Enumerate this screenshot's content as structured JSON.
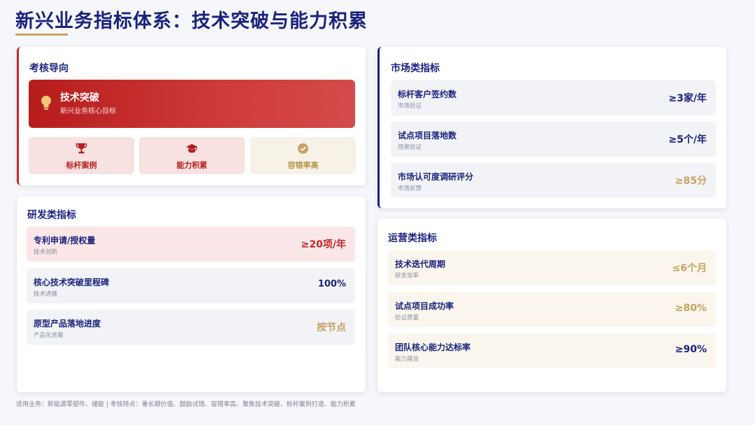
{
  "page": {
    "title": "新兴业务指标体系：技术突破与能力积累",
    "footer": "适用业务：新能源零部件、储能 | 考核特点：重长期价值、鼓励试错、容错率高、聚焦技术突破、标杆案例打造、能力积累"
  },
  "orientation": {
    "title": "考核导向",
    "banner": {
      "icon": "lightbulb-icon",
      "title": "技术突破",
      "subtitle": "新兴业务核心目标"
    },
    "tags": [
      {
        "icon": "trophy-icon",
        "label": "标杆案例"
      },
      {
        "icon": "graduation-cap-icon",
        "label": "能力积累"
      },
      {
        "icon": "check-circle-icon",
        "label": "容错率高"
      }
    ]
  },
  "rd": {
    "title": "研发类指标",
    "items": [
      {
        "name": "专利申请/授权量",
        "sub": "技术创新",
        "value": "≥20项/年"
      },
      {
        "name": "核心技术突破里程碑",
        "sub": "技术进展",
        "value": "100%"
      },
      {
        "name": "原型产品落地进度",
        "sub": "产品化进展",
        "value": "按节点"
      }
    ]
  },
  "market": {
    "title": "市场类指标",
    "items": [
      {
        "name": "标杆客户签约数",
        "sub": "市场验证",
        "value": "≥3家/年"
      },
      {
        "name": "试点项目落地数",
        "sub": "场景验证",
        "value": "≥5个/年"
      },
      {
        "name": "市场认可度调研评分",
        "sub": "市场反馈",
        "value": "≥85分"
      }
    ]
  },
  "ops": {
    "title": "运营类指标",
    "items": [
      {
        "name": "技术迭代周期",
        "sub": "研发效率",
        "value": "≤6个月"
      },
      {
        "name": "试点项目成功率",
        "sub": "验证质量",
        "value": "≥80%"
      },
      {
        "name": "团队核心能力达标率",
        "sub": "能力建设",
        "value": "≥90%"
      }
    ]
  },
  "colors": {
    "navy": "#1a237e",
    "red": "#c62828",
    "gold": "#c8a35a"
  }
}
